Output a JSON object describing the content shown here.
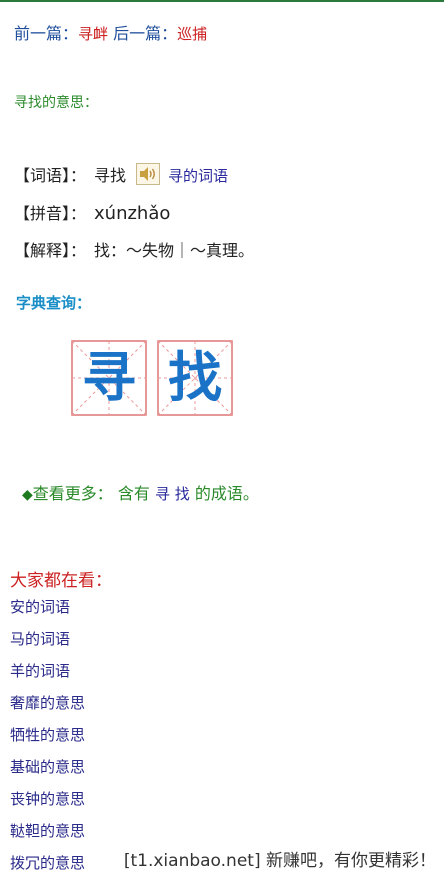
{
  "nav": {
    "prev_label": "前一篇：",
    "prev_link": "寻衅",
    "next_label": "后一篇：",
    "next_link": "巡捕"
  },
  "meaning": {
    "title": "寻找的意思："
  },
  "entry": {
    "word_label": "【词语】：",
    "word": "寻找",
    "speaker_icon": "speaker-icon",
    "related_link": "寻的词语",
    "pinyin_label": "【拼音】：",
    "pinyin": "xúnzhǎo",
    "explain_label": "【解释】：",
    "explain": "找：～失物｜～真理。"
  },
  "dictionary": {
    "title": "字典查询：",
    "chars": [
      "寻",
      "找"
    ]
  },
  "more": {
    "prefix": "查看更多：",
    "middle": "含有",
    "chars": "寻 找",
    "suffix": "的成语。"
  },
  "popular": {
    "title": "大家都在看：",
    "items": [
      "安的词语",
      "马的词语",
      "羊的词语",
      "奢靡的意思",
      "牺牲的意思",
      "基础的意思",
      "丧钟的意思",
      "鞑靼的意思",
      "拨冗的意思"
    ]
  },
  "watermark": "[t1.xianbao.net] 新赚吧，有你更精彩！",
  "colors": {
    "accent_blue": "#1a73c7",
    "link_red": "#cc2222",
    "heading_green": "#2d8b2d"
  }
}
